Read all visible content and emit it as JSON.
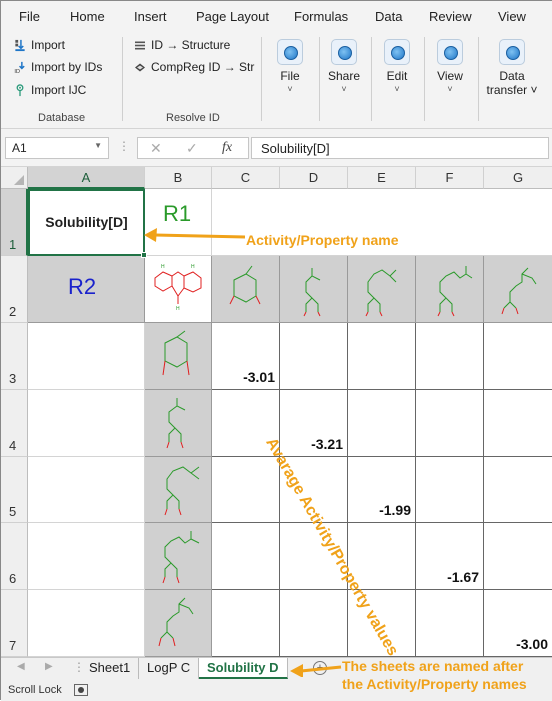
{
  "menu": {
    "tabs": [
      "File",
      "Home",
      "Insert",
      "Page Layout",
      "Formulas",
      "Data",
      "Review",
      "View"
    ]
  },
  "ribbon": {
    "database": {
      "label": "Database",
      "buttons": [
        "Import",
        "Import by IDs",
        "Import IJC"
      ]
    },
    "resolve_id": {
      "label": "Resolve ID",
      "buttons": [
        "ID → Structure",
        "CompReg ID → Str"
      ]
    },
    "big_buttons": [
      {
        "label": "File",
        "chevron": "˅"
      },
      {
        "label": "Share",
        "chevron": "˅"
      },
      {
        "label": "Edit",
        "chevron": "˅"
      },
      {
        "label": "View",
        "chevron": "˅"
      },
      {
        "label": "Data",
        "label2": "transfer ˅"
      }
    ]
  },
  "formula_bar": {
    "name_box": "A1",
    "cancel_icon": "✕",
    "enter_icon": "✓",
    "fx": "fx",
    "formula": "Solubility[D]"
  },
  "columns": [
    "A",
    "B",
    "C",
    "D",
    "E",
    "F",
    "G"
  ],
  "rows": [
    "1",
    "2",
    "3",
    "4",
    "5",
    "6",
    "7"
  ],
  "cells": {
    "A1": "Solubility[D]",
    "B1": "R1",
    "A2": "R2",
    "C3": "-3.01",
    "D4": "-3.21",
    "E5": "-1.99",
    "F6": "-1.67",
    "G7": "-3.00"
  },
  "annotations": {
    "activity_name": "Activity/Property name",
    "average_values": "Avarage Activity/Property values",
    "sheet_note_line1": "The sheets are named after",
    "sheet_note_line2": "the Activity/Property names",
    "accent_color": "#f0a21a"
  },
  "sheets": {
    "tabs": [
      "Sheet1",
      "LogP C",
      "Solubility D"
    ],
    "active": "Solubility D",
    "add_icon": "+"
  },
  "status": {
    "text": "Scroll Lock"
  },
  "colors": {
    "excel_green": "#217346",
    "r1_color": "#2a9a2a",
    "r2_color": "#1a22cc",
    "molecule_green": "#2a9a2a",
    "molecule_red": "#e02020"
  }
}
